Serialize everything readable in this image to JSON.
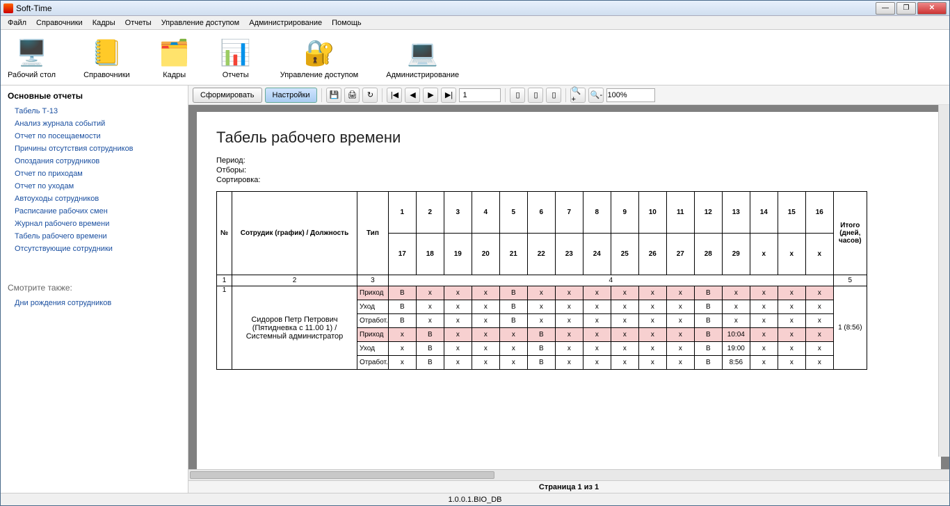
{
  "window": {
    "title": "Soft-Time"
  },
  "menu": [
    "Файл",
    "Справочники",
    "Кадры",
    "Отчеты",
    "Управление доступом",
    "Администрирование",
    "Помощь"
  ],
  "toolbar": [
    {
      "label": "Рабочий стол",
      "icon": "🖥️"
    },
    {
      "label": "Справочники",
      "icon": "📒"
    },
    {
      "label": "Кадры",
      "icon": "🗂️"
    },
    {
      "label": "Отчеты",
      "icon": "📊"
    },
    {
      "label": "Управление доступом",
      "icon": "🔐"
    },
    {
      "label": "Администрирование",
      "icon": "💻"
    }
  ],
  "sidebar": {
    "heading": "Основные отчеты",
    "links": [
      "Табель Т-13",
      "Анализ журнала событий",
      "Отчет по посещаемости",
      "Причины отсутствия сотрудников",
      "Опоздания сотрудников",
      "Отчет по приходам",
      "Отчет по уходам",
      "Автоуходы сотрудников",
      "Расписание рабочих смен",
      "Журнал рабочего времени",
      "Табель рабочего времени",
      "Отсутствующие сотрудники"
    ],
    "also_heading": "Смотрите также:",
    "also_links": [
      "Дни рождения сотрудников"
    ]
  },
  "report_tb": {
    "form": "Сформировать",
    "settings": "Настройки",
    "page": "1",
    "zoom": "100%"
  },
  "report": {
    "title": "Табель рабочего времени",
    "meta": {
      "period": "Период:",
      "filter": "Отборы:",
      "sort": "Сортировка:"
    },
    "headers": {
      "num": "№",
      "employee": "Сотрудик (график) / Должность",
      "type": "Тип",
      "days_top": [
        "1",
        "2",
        "3",
        "4",
        "5",
        "6",
        "7",
        "8",
        "9",
        "10",
        "11",
        "12",
        "13",
        "14",
        "15",
        "16"
      ],
      "days_bot": [
        "17",
        "18",
        "19",
        "20",
        "21",
        "22",
        "23",
        "24",
        "25",
        "26",
        "27",
        "28",
        "29",
        "x",
        "x",
        "x"
      ],
      "total": "Итого (дней, часов)"
    },
    "subheader": {
      "c1": "1",
      "c2": "2",
      "c3": "3",
      "c4": "4",
      "c5": "5"
    },
    "row": {
      "num": "1",
      "employee": "Сидоров Петр Петрович (Пятидневка с 11.00 1)  / Системный администратор",
      "total": "1 (8:56)",
      "types": [
        "Приход",
        "Уход",
        "Отработ.",
        "Приход",
        "Уход",
        "Отработ."
      ],
      "data": [
        [
          "B",
          "x",
          "x",
          "x",
          "B",
          "x",
          "x",
          "x",
          "x",
          "x",
          "x",
          "B",
          "x",
          "x",
          "x",
          "x"
        ],
        [
          "B",
          "x",
          "x",
          "x",
          "B",
          "x",
          "x",
          "x",
          "x",
          "x",
          "x",
          "B",
          "x",
          "x",
          "x",
          "x"
        ],
        [
          "B",
          "x",
          "x",
          "x",
          "B",
          "x",
          "x",
          "x",
          "x",
          "x",
          "x",
          "B",
          "x",
          "x",
          "x",
          "x"
        ],
        [
          "x",
          "B",
          "x",
          "x",
          "x",
          "B",
          "x",
          "x",
          "x",
          "x",
          "x",
          "B",
          "10:04",
          "x",
          "x",
          "x"
        ],
        [
          "x",
          "B",
          "x",
          "x",
          "x",
          "B",
          "x",
          "x",
          "x",
          "x",
          "x",
          "B",
          "19:00",
          "x",
          "x",
          "x"
        ],
        [
          "x",
          "B",
          "x",
          "x",
          "x",
          "B",
          "x",
          "x",
          "x",
          "x",
          "x",
          "B",
          "8:56",
          "x",
          "x",
          "x"
        ]
      ],
      "pink_rows": [
        0,
        3
      ]
    }
  },
  "pager": "Страница 1 из 1",
  "status": "1.0.0.1.BIO_DB"
}
